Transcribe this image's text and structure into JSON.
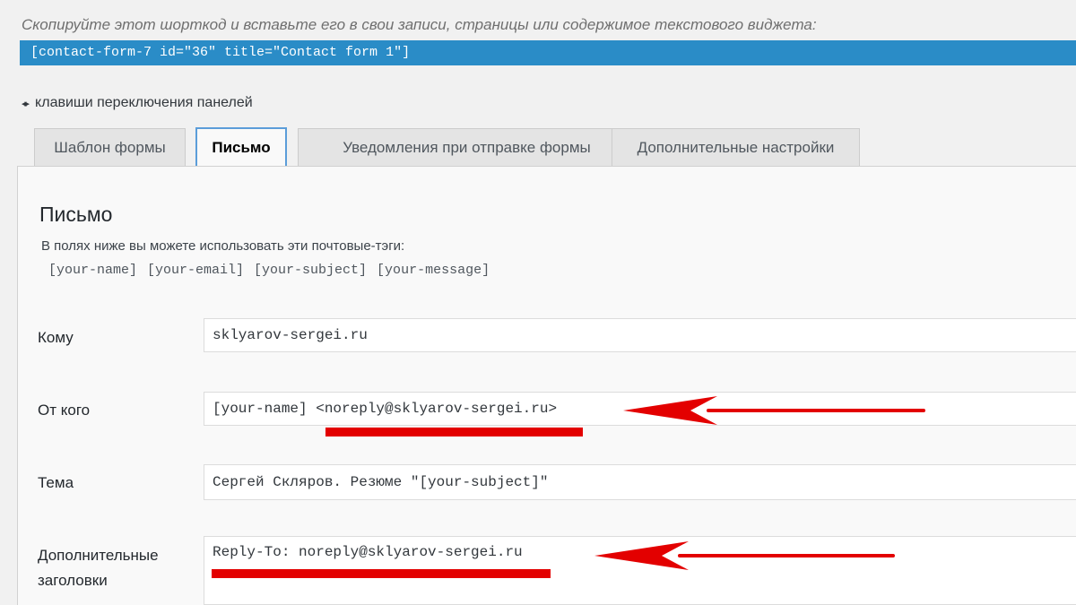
{
  "shortcode_hint": "Скопируйте этот шорткод и вставьте его в свои записи, страницы или содержимое текстового виджета:",
  "shortcode": "[contact-form-7 id=\"36\" title=\"Contact form 1\"]",
  "panel_switch_hint": {
    "arrows": "◂▸",
    "text": "клавиши переключения панелей"
  },
  "tabs": [
    {
      "label": "Шаблон формы",
      "active": false
    },
    {
      "label": "Письмо",
      "active": true
    },
    {
      "label": "Уведомления при отправке формы",
      "active": false
    },
    {
      "label": "Дополнительные настройки",
      "active": false
    }
  ],
  "panel": {
    "title": "Письмо",
    "description": "В полях ниже вы можете использовать эти почтовые-тэги:",
    "mail_tags": "[your-name] [your-email] [your-subject] [your-message]"
  },
  "fields": {
    "to": {
      "label": "Кому",
      "value": "sklyarov-sergei.ru"
    },
    "from": {
      "label": "От кого",
      "value": "[your-name] <noreply@sklyarov-sergei.ru>"
    },
    "subject": {
      "label": "Тема",
      "value": "Сергей Скляров. Резюме \"[your-subject]\""
    },
    "headers": {
      "label_line1": "Дополнительные",
      "label_line2": "заголовки",
      "value": "Reply-To: noreply@sklyarov-sergei.ru"
    }
  },
  "colors": {
    "shortcode_bg": "#2a8cc7",
    "annotation": "#e30000",
    "active_tab_border": "#5b9dd9"
  },
  "icons": [
    "left-right-arrows-icon",
    "red-annotation-arrow-icon"
  ]
}
